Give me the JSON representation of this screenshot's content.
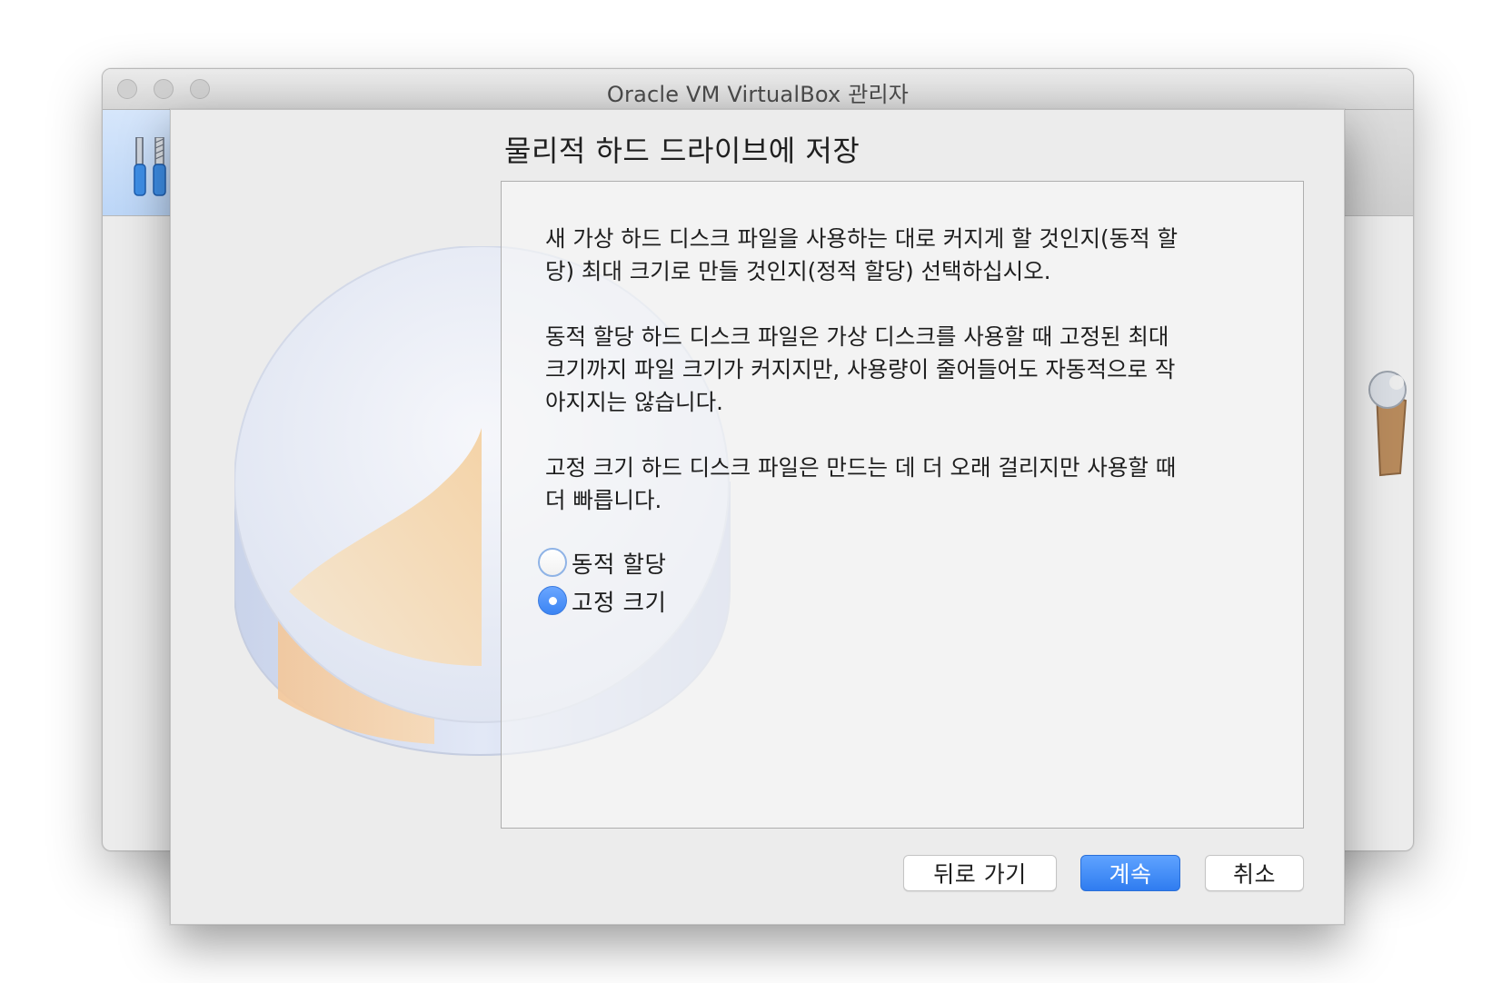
{
  "window": {
    "title": "Oracle VM VirtualBox 관리자"
  },
  "toolbar": {
    "tools_icon": "tools-icon"
  },
  "wizard": {
    "page_title": "물리적 하드 드라이브에 저장",
    "paragraphs": [
      "새 가상 하드 디스크 파일을 사용하는 대로 커지게 할 것인지(동적 할\n당) 최대 크기로 만들 것인지(정적 할당) 선택하십시오.",
      "동적 할당 하드 디스크 파일은 가상 디스크를 사용할 때 고정된 최대\n크기까지 파일 크기가 커지지만, 사용량이 줄어들어도 자동적으로 작\n아지지는 않습니다.",
      "고정 크기 하드 디스크 파일은 만드는 데 더 오래 걸리지만 사용할 때\n더 빠릅니다."
    ],
    "options": [
      {
        "label": "동적 할당",
        "selected": false
      },
      {
        "label": "고정 크기",
        "selected": true
      }
    ],
    "buttons": {
      "back": "뒤로 가기",
      "next": "계속",
      "cancel": "취소"
    },
    "accent_color": "#3b84f3"
  }
}
